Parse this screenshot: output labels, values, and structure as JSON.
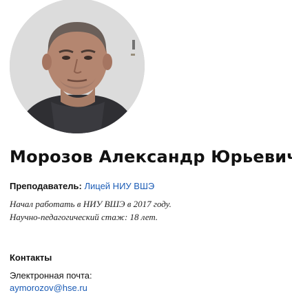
{
  "person": {
    "full_name": "Морозов Александр Юрьевич",
    "position_label": "Преподаватель:",
    "position_link": "Лицей НИУ ВШЭ",
    "bio_line1": "Начал работать в НИУ ВШЭ в 2017 году.",
    "bio_line2": "Научно-педагогический стаж: 18 лет."
  },
  "contacts": {
    "heading": "Контакты",
    "email_label": "Электронная почта:",
    "email": "aymorozov@hse.ru"
  },
  "colors": {
    "link": "#1a5bb5",
    "text": "#111111"
  }
}
